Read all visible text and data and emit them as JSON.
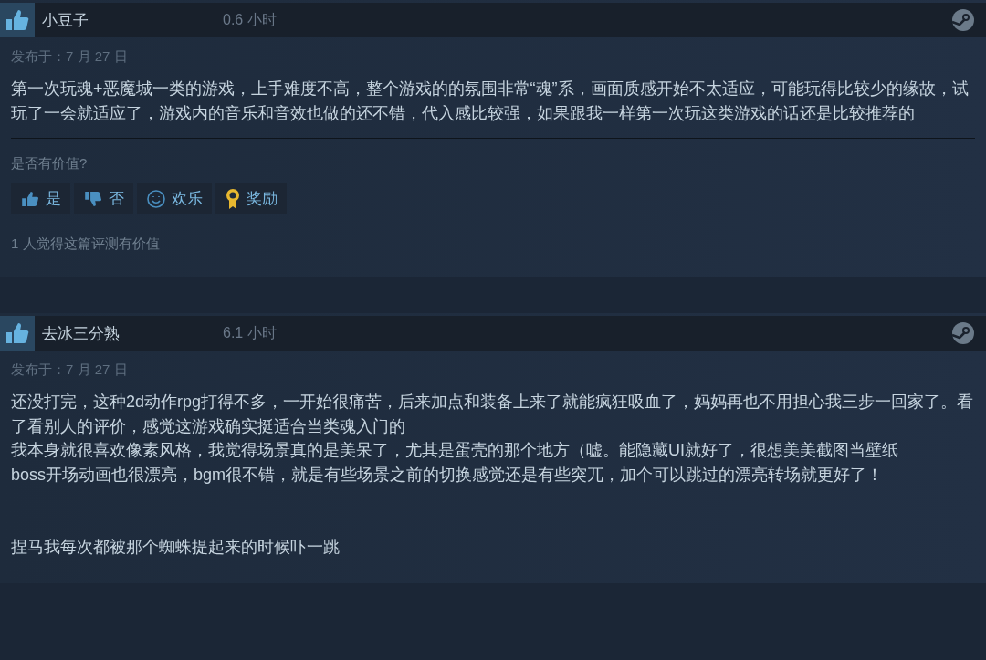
{
  "reviews": [
    {
      "author": "小豆子",
      "recommended": true,
      "hours": "0.6 小时",
      "date": "发布于：7 月 27 日",
      "body": "第一次玩魂+恶魔城一类的游戏，上手难度不高，整个游戏的的氛围非常“魂”系，画面质感开始不太适应，可能玩得比较少的缘故，试玩了一会就适应了，游戏内的音乐和音效也做的还不错，代入感比较强，如果跟我一样第一次玩这类游戏的话还是比较推荐的",
      "helpful_prompt": "是否有价值?",
      "votes": [
        {
          "kind": "yes",
          "label": "是"
        },
        {
          "kind": "no",
          "label": "否"
        },
        {
          "kind": "funny",
          "label": "欢乐"
        },
        {
          "kind": "award",
          "label": "奖励"
        }
      ],
      "helpful_count": "1 人觉得这篇评测有价值"
    },
    {
      "author": "去冰三分熟",
      "recommended": true,
      "hours": "6.1 小时",
      "date": "发布于：7 月 27 日",
      "paragraphs": [
        {
          "kind": "line",
          "text": "还没打完，这种2d动作rpg打得不多，一开始很痛苦，后来加点和装备上来了就能疯狂吸血了，妈妈再也不用担心我三步一回家了。看了看别人的评价，感觉这游戏确实挺适合当类魂入门的"
        },
        {
          "kind": "line",
          "text": "我本身就很喜欢像素风格，我觉得场景真的是美呆了，尤其是蛋壳的那个地方（嘘。能隐藏UI就好了，很想美美截图当壁纸"
        },
        {
          "kind": "line",
          "text": "boss开场动画也很漂亮，bgm很不错，就是有些场景之前的切换感觉还是有些突兀，加个可以跳过的漂亮转场就更好了！"
        },
        {
          "kind": "after_blank_lines",
          "text": "捏马我每次都被那个蜘蛛提起来的时候吓一跳"
        }
      ]
    }
  ]
}
